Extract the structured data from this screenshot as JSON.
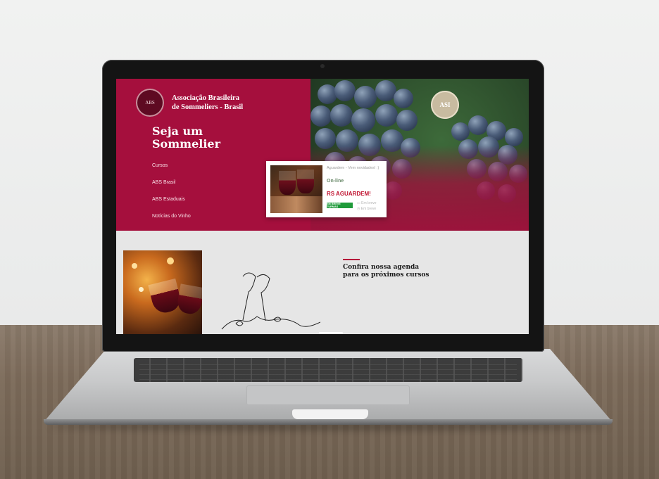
{
  "site": {
    "brand_line1": "Associação Brasileira",
    "brand_line2": "de Sommeliers - Brasil",
    "headline_line1": "Seja um",
    "headline_line2": "Sommelier",
    "nav": [
      "Cursos",
      "ABS Brasil",
      "ABS Estaduais",
      "Notícias do Vinho"
    ],
    "badge": "ASI"
  },
  "card": {
    "subtitle": "Aguardem - Vem novidades! :)",
    "mode": "On-line",
    "title": "RS AGUARDEM!",
    "button": "EM BREVE TURMAS",
    "date": "Em breve",
    "time": "Em breve"
  },
  "agenda": {
    "line1": "Confira nossa agenda",
    "line2": "para os próximos cursos"
  },
  "colors": {
    "brand": "#a50f3d",
    "button": "#1f9a3a"
  }
}
